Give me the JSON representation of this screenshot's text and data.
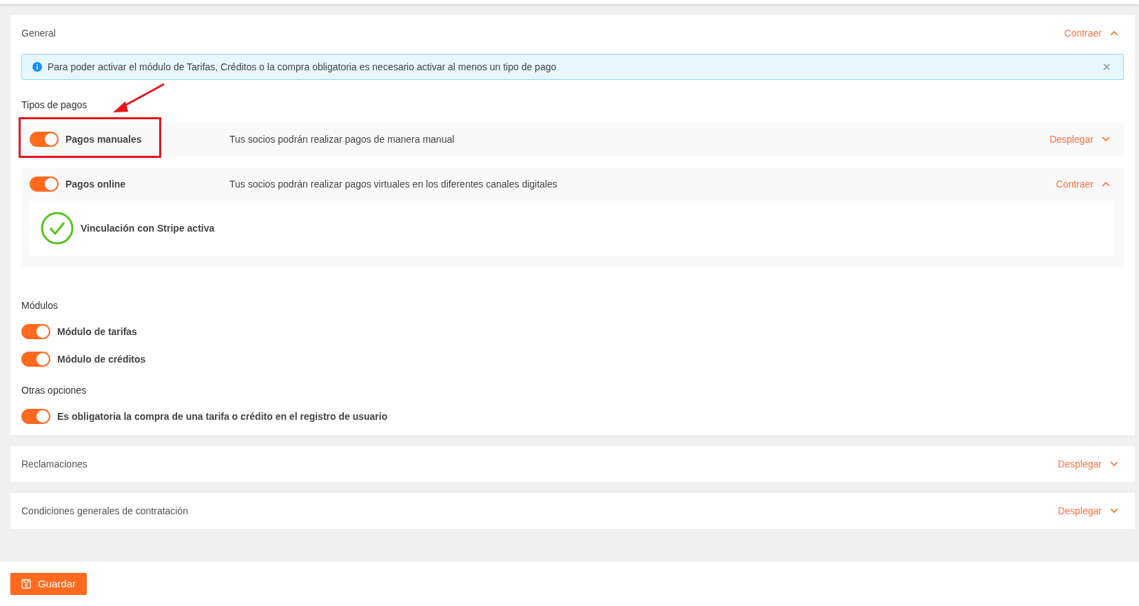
{
  "general": {
    "title": "General",
    "action": "Contraer",
    "expanded": true,
    "alert": {
      "text": "Para poder activar el módulo de Tarifas, Créditos o la compra obligatoria es necesario activar al menos un tipo de pago",
      "dismissible": true
    },
    "payment_types": {
      "heading": "Tipos de pagos",
      "items": [
        {
          "label": "Pagos manuales",
          "description": "Tus socios podrán realizar pagos de manera manual",
          "on": true,
          "action": "Desplegar",
          "expanded": false,
          "highlighted": true
        },
        {
          "label": "Pagos online",
          "description": "Tus socios podrán realizar pagos virtuales en los diferentes canales digitales",
          "on": true,
          "action": "Contraer",
          "expanded": true,
          "highlighted": false,
          "status": "Vinculación con Stripe activa"
        }
      ]
    },
    "modules": {
      "heading": "Módulos",
      "items": [
        {
          "label": "Módulo de tarifas",
          "on": true
        },
        {
          "label": "Módulo de créditos",
          "on": true
        }
      ]
    },
    "other_options": {
      "heading": "Otras opciones",
      "items": [
        {
          "label": "Es obligatoria la compra de una tarifa o crédito en el registro de usuario",
          "on": true
        }
      ]
    }
  },
  "sections": [
    {
      "title": "Reclamaciones",
      "action": "Desplegar",
      "expanded": false
    },
    {
      "title": "Condiciones generales de contratación",
      "action": "Desplegar",
      "expanded": false
    }
  ],
  "save_button": "Guardar"
}
